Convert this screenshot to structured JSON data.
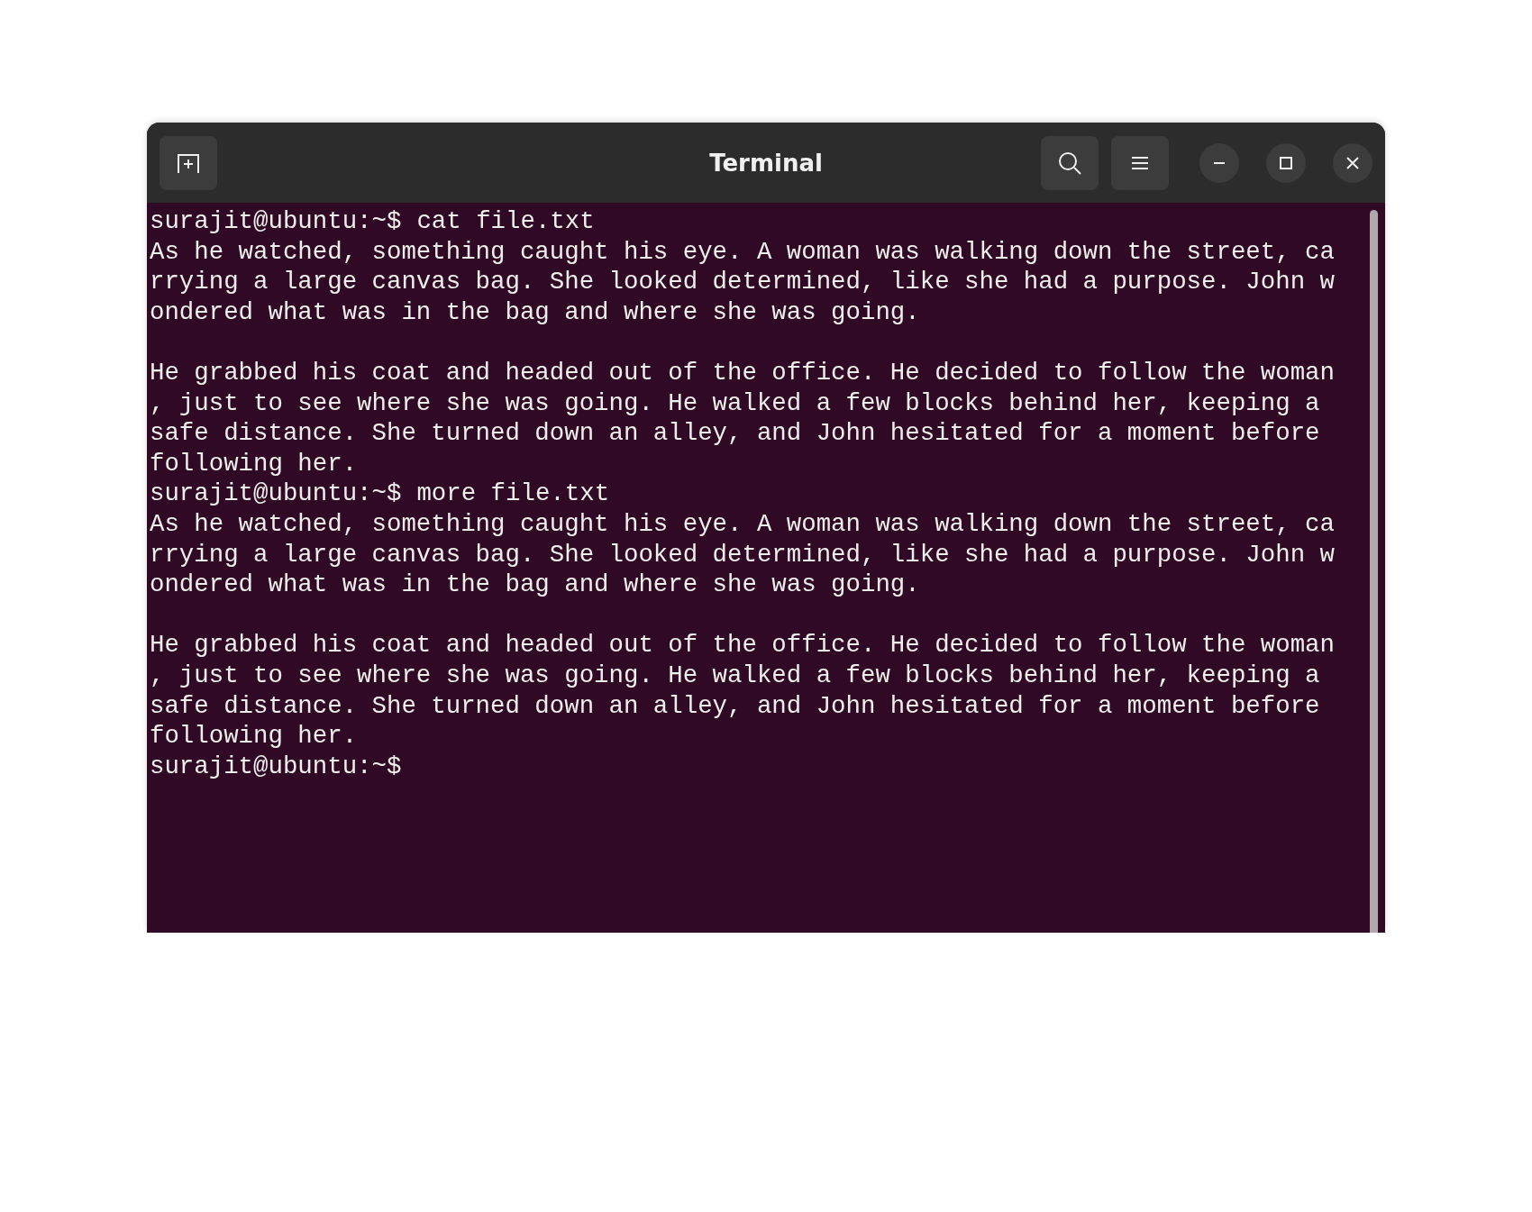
{
  "window": {
    "title": "Terminal"
  },
  "terminal": [
    {
      "kind": "prompt",
      "prompt": "surajit@ubuntu:~$",
      "command": "cat file.txt"
    },
    {
      "kind": "output",
      "paragraphs": [
        [
          "As he watched, something caught his eye. A woman was walking down the street, ca",
          "rrying a large canvas bag. She looked determined, like she had a purpose. John w",
          "ondered what was in the bag and where she was going."
        ],
        [
          "He grabbed his coat and headed out of the office. He decided to follow the woman",
          ", just to see where she was going. He walked a few blocks behind her, keeping a",
          "safe distance. She turned down an alley, and John hesitated for a moment before",
          "following her."
        ]
      ]
    },
    {
      "kind": "prompt",
      "prompt": "surajit@ubuntu:~$",
      "command": "more file.txt"
    },
    {
      "kind": "output",
      "paragraphs": [
        [
          "As he watched, something caught his eye. A woman was walking down the street, ca",
          "rrying a large canvas bag. She looked determined, like she had a purpose. John w",
          "ondered what was in the bag and where she was going."
        ],
        [
          "He grabbed his coat and headed out of the office. He decided to follow the woman",
          ", just to see where she was going. He walked a few blocks behind her, keeping a",
          "safe distance. She turned down an alley, and John hesitated for a moment before",
          "following her."
        ]
      ]
    },
    {
      "kind": "prompt",
      "prompt": "surajit@ubuntu:~$"
    }
  ]
}
